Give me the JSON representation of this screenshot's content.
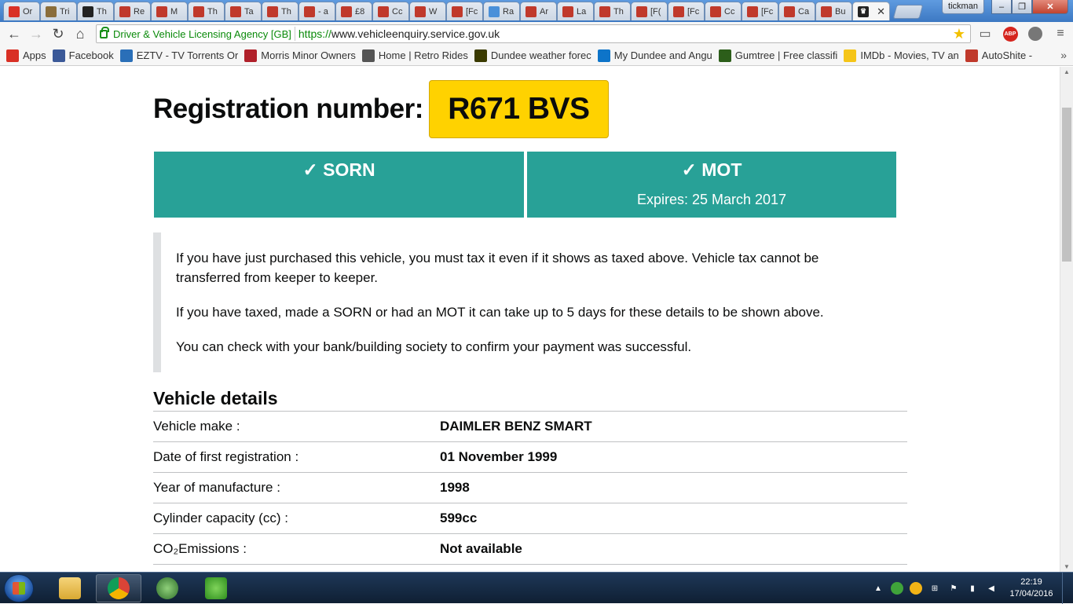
{
  "browser": {
    "tabs": [
      {
        "title": "Or",
        "favicon": "gmail-icon",
        "color": "#d93025"
      },
      {
        "title": "Tri",
        "favicon": "bird-icon",
        "color": "#8a6d3b"
      },
      {
        "title": "Th",
        "favicon": "d-circle-icon",
        "color": "#222222"
      },
      {
        "title": "Re",
        "favicon": "morris-bus-icon",
        "color": "#c0392b"
      },
      {
        "title": "M",
        "favicon": "morris-bus-icon",
        "color": "#c0392b"
      },
      {
        "title": "Th",
        "favicon": "morris-bus-icon",
        "color": "#c0392b"
      },
      {
        "title": "Ta",
        "favicon": "morris-bus-icon",
        "color": "#c0392b"
      },
      {
        "title": "Th",
        "favicon": "morris-bus-icon",
        "color": "#c0392b"
      },
      {
        "title": "- a",
        "favicon": "morris-bus-icon",
        "color": "#c0392b"
      },
      {
        "title": "£8",
        "favicon": "morris-bus-icon",
        "color": "#c0392b"
      },
      {
        "title": "Cc",
        "favicon": "morris-bus-icon",
        "color": "#c0392b"
      },
      {
        "title": "W",
        "favicon": "morris-bus-icon",
        "color": "#c0392b"
      },
      {
        "title": "[Fc",
        "favicon": "morris-bus-icon",
        "color": "#c0392b"
      },
      {
        "title": "Ra",
        "favicon": "loading-spinner-icon",
        "color": "#4a90d9"
      },
      {
        "title": "Ar",
        "favicon": "morris-bus-icon",
        "color": "#c0392b"
      },
      {
        "title": "La",
        "favicon": "morris-bus-icon",
        "color": "#c0392b"
      },
      {
        "title": "Th",
        "favicon": "morris-bus-icon",
        "color": "#c0392b"
      },
      {
        "title": "[F(",
        "favicon": "morris-bus-icon",
        "color": "#c0392b"
      },
      {
        "title": "[Fc",
        "favicon": "morris-bus-icon",
        "color": "#c0392b"
      },
      {
        "title": "Cc",
        "favicon": "morris-bus-icon",
        "color": "#c0392b"
      },
      {
        "title": "[Fc",
        "favicon": "morris-bus-icon",
        "color": "#c0392b"
      },
      {
        "title": "Ca",
        "favicon": "morris-bus-icon",
        "color": "#c0392b"
      },
      {
        "title": "Bu",
        "favicon": "morris-bus-icon",
        "color": "#c0392b"
      }
    ],
    "active_tab": {
      "favicon": "crown-icon",
      "close": "✕"
    },
    "user_name": "tickman",
    "window_buttons": {
      "minimize": "–",
      "maximize": "❐",
      "close": "✕"
    },
    "ev_name": "Driver & Vehicle Licensing Agency [GB]",
    "url_scheme": "https://",
    "url_host": "www.vehicleenquiry.service.gov.uk"
  },
  "bookmarks": [
    {
      "label": "Apps",
      "icon": "apps-grid-icon",
      "color": "#d93025"
    },
    {
      "label": "Facebook",
      "icon": "facebook-icon",
      "color": "#3b5998"
    },
    {
      "label": "EZTV - TV Torrents Or",
      "icon": "eztv-icon",
      "color": "#2a6fb8"
    },
    {
      "label": "Morris Minor Owners",
      "icon": "morris-badge-icon",
      "color": "#b0202a"
    },
    {
      "label": "Home | Retro Rides",
      "icon": "retro-rides-icon",
      "color": "#555555"
    },
    {
      "label": "Dundee weather forec",
      "icon": "weather-icon",
      "color": "#3a3a00"
    },
    {
      "label": "My Dundee and Angu",
      "icon": "da-icon",
      "color": "#0d74c9"
    },
    {
      "label": "Gumtree | Free classifi",
      "icon": "gumtree-icon",
      "color": "#2c5e1a"
    },
    {
      "label": "IMDb - Movies, TV an",
      "icon": "imdb-icon",
      "color": "#f5c518"
    },
    {
      "label": "AutoShite -",
      "icon": "autoshite-icon",
      "color": "#c0392b"
    }
  ],
  "page": {
    "reg_label": "Registration number:",
    "reg_plate": "R671 BVS",
    "sorn_title": "✓ SORN",
    "mot_title": "✓ MOT",
    "mot_expiry": "Expires: 25 March 2017",
    "notice": [
      "If you have just purchased this vehicle, you must tax it even if it shows as taxed above. Vehicle tax cannot be transferred from keeper to keeper.",
      "If you have taxed, made a SORN or had an MOT it can take up to 5 days for these details to be shown above.",
      "You can check with your bank/building society to confirm your payment was successful."
    ],
    "details_heading": "Vehicle details",
    "details": [
      {
        "label": "Vehicle make :",
        "value": "DAIMLER BENZ SMART"
      },
      {
        "label": "Date of first registration :",
        "value": "01 November 1999"
      },
      {
        "label": "Year of manufacture :",
        "value": "1998"
      },
      {
        "label": "Cylinder capacity (cc) :",
        "value": "599cc"
      },
      {
        "label": "CO₂Emissions :",
        "value": "Not available"
      }
    ]
  },
  "taskbar": {
    "time": "22:19",
    "date": "17/04/2016"
  },
  "colors": {
    "plate": "#ffd200",
    "status_green": "#28a197",
    "text": "#0b0c0c"
  }
}
